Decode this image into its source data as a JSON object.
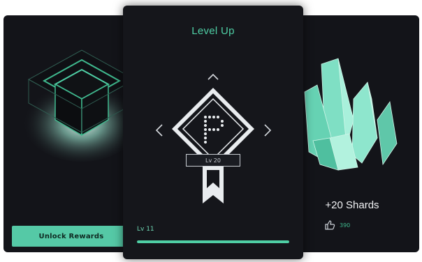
{
  "left_card": {
    "unlock_label": "Unlock Rewards"
  },
  "level_card": {
    "title": "Level Up",
    "badge_level": "Lv 20",
    "current_level": "Lv 11",
    "progress": 1.0,
    "emblem_glyph": "P"
  },
  "reward_card": {
    "reward_label": "+20 Shards",
    "reward_value": "390",
    "reward_icon": "thumbs-up-icon"
  },
  "colors": {
    "accent": "#4fcfa5",
    "card_bg": "#131419",
    "crystal": "#8ee6cd"
  }
}
